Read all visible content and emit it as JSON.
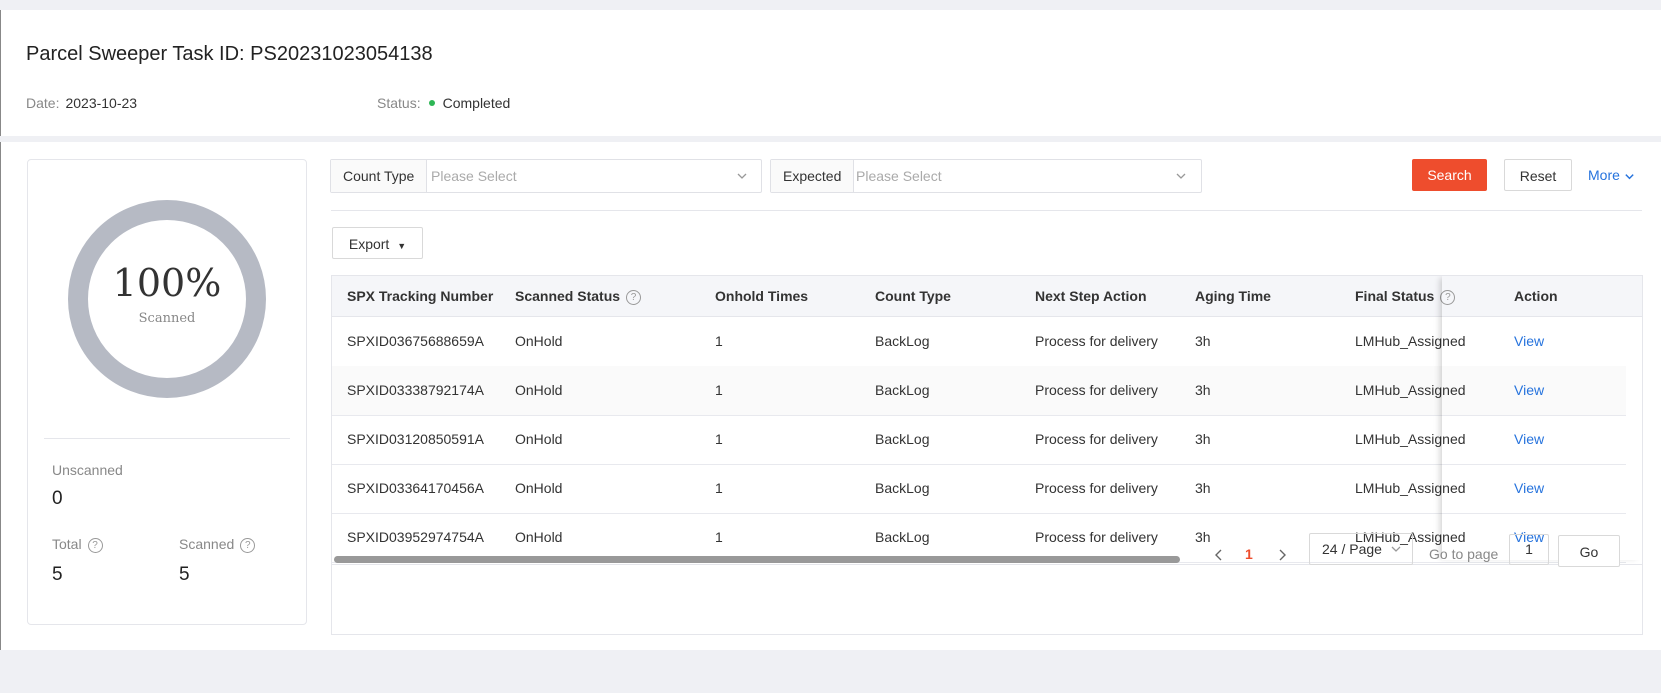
{
  "header": {
    "title": "Parcel Sweeper Task ID: PS20231023054138",
    "date_label": "Date:",
    "date_value": "2023-10-23",
    "status_label": "Status:",
    "status_value": "Completed",
    "status_color": "#2db655"
  },
  "summary": {
    "percent_text": "100%",
    "percent_caption": "Scanned",
    "scanned_fraction": 1.0,
    "ring_color": "#b6bac4",
    "unscanned_label": "Unscanned",
    "unscanned_value": "0",
    "total_label": "Total",
    "total_value": "5",
    "scanned_label": "Scanned",
    "scanned_value": "5"
  },
  "filters": {
    "count_type_label": "Count Type",
    "count_type_placeholder": "Please Select",
    "expected_label": "Expected",
    "expected_placeholder": "Please Select",
    "search_label": "Search",
    "reset_label": "Reset",
    "more_label": "More"
  },
  "toolbar": {
    "export_label": "Export"
  },
  "table": {
    "columns": [
      "SPX Tracking Number",
      "Scanned Status",
      "Onhold Times",
      "Count Type",
      "Next Step Action",
      "Aging Time",
      "Final Status",
      "Action"
    ],
    "rows": [
      [
        "SPXID03675688659A",
        "OnHold",
        "1",
        "BackLog",
        "Process for delivery",
        "3h",
        "LMHub_Assigned",
        "View"
      ],
      [
        "SPXID03338792174A",
        "OnHold",
        "1",
        "BackLog",
        "Process for delivery",
        "3h",
        "LMHub_Assigned",
        "View"
      ],
      [
        "SPXID03120850591A",
        "OnHold",
        "1",
        "BackLog",
        "Process for delivery",
        "3h",
        "LMHub_Assigned",
        "View"
      ],
      [
        "SPXID03364170456A",
        "OnHold",
        "1",
        "BackLog",
        "Process for delivery",
        "3h",
        "LMHub_Assigned",
        "View"
      ],
      [
        "SPXID03952974754A",
        "OnHold",
        "1",
        "BackLog",
        "Process for delivery",
        "3h",
        "LMHub_Assigned",
        "View"
      ]
    ]
  },
  "pagination": {
    "current_page": "1",
    "page_size": "24 / Page",
    "goto_label": "Go to page",
    "goto_value": "1",
    "go_label": "Go"
  },
  "accent_colors": {
    "primary": "#ee4d2d",
    "link": "#2673dd"
  }
}
